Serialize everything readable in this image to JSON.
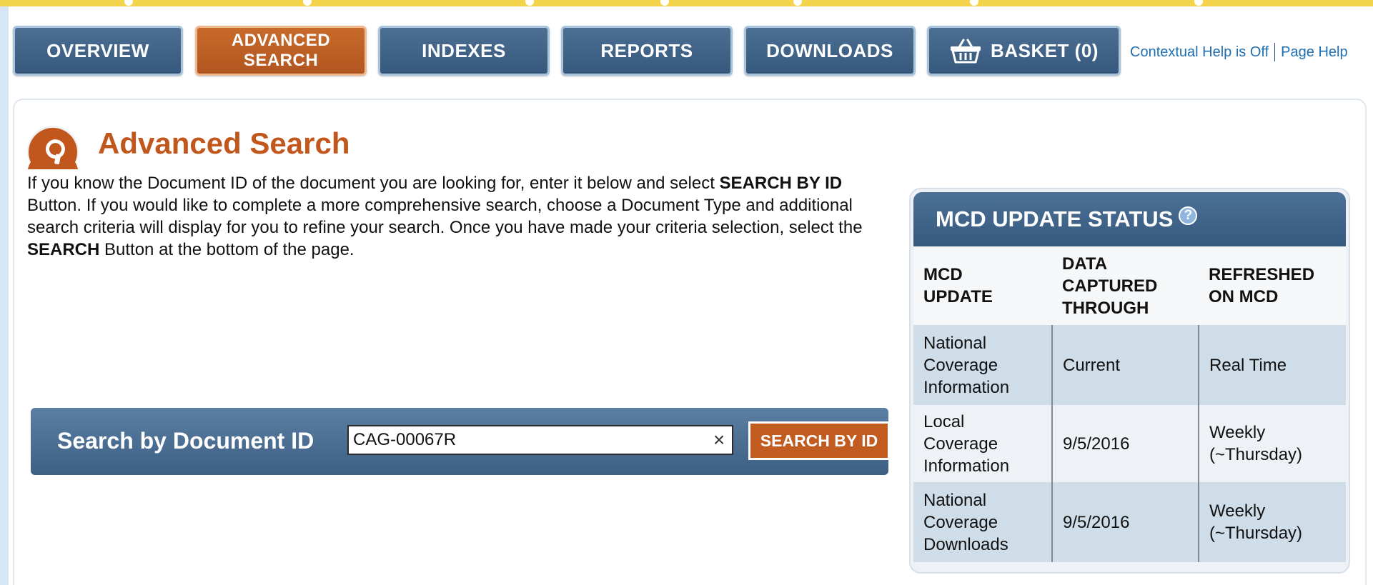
{
  "nav": {
    "overview": "OVERVIEW",
    "advanced_search_line1": "ADVANCED",
    "advanced_search_line2": "SEARCH",
    "indexes": "INDEXES",
    "reports": "REPORTS",
    "downloads": "DOWNLOADS",
    "basket": "BASKET (0)",
    "basket_icon": "basket-icon",
    "active_color": "#c2571d",
    "base_color": "#3f6286"
  },
  "help": {
    "contextual": "Contextual Help is Off",
    "page_help": "Page Help"
  },
  "page": {
    "title": "Advanced Search",
    "title_icon": "search-icon",
    "intro_1": "If you know the Document ID of the document you are looking for, enter it below and select ",
    "intro_bold_1": "SEARCH BY ID",
    "intro_2": " Button. If you would like to complete a more comprehensive search, choose a Document Type and additional search criteria will display for you to refine your search. Once you have made your criteria selection, select the ",
    "intro_bold_2": "SEARCH",
    "intro_3": " Button at the bottom of the page."
  },
  "search_by_id": {
    "label": "Search by Document ID",
    "value": "CAG-00067R",
    "clear_glyph": "×",
    "button": "SEARCH BY ID"
  },
  "mcd_status": {
    "title": "MCD UPDATE STATUS",
    "info_glyph": "?",
    "headers": [
      [
        "MCD",
        "UPDATE"
      ],
      [
        "DATA",
        "CAPTURED",
        "THROUGH"
      ],
      [
        "REFRESHED",
        "ON MCD"
      ]
    ],
    "rows": [
      {
        "update": [
          "National",
          "Coverage",
          "Information"
        ],
        "captured": "Current",
        "refreshed": [
          "Real Time"
        ]
      },
      {
        "update": [
          "Local",
          "Coverage",
          "Information"
        ],
        "captured": "9/5/2016",
        "refreshed": [
          "Weekly",
          "(~Thursday)"
        ]
      },
      {
        "update": [
          "National",
          "Coverage",
          "Downloads"
        ],
        "captured": "9/5/2016",
        "refreshed": [
          "Weekly",
          "(~Thursday)"
        ]
      }
    ]
  }
}
